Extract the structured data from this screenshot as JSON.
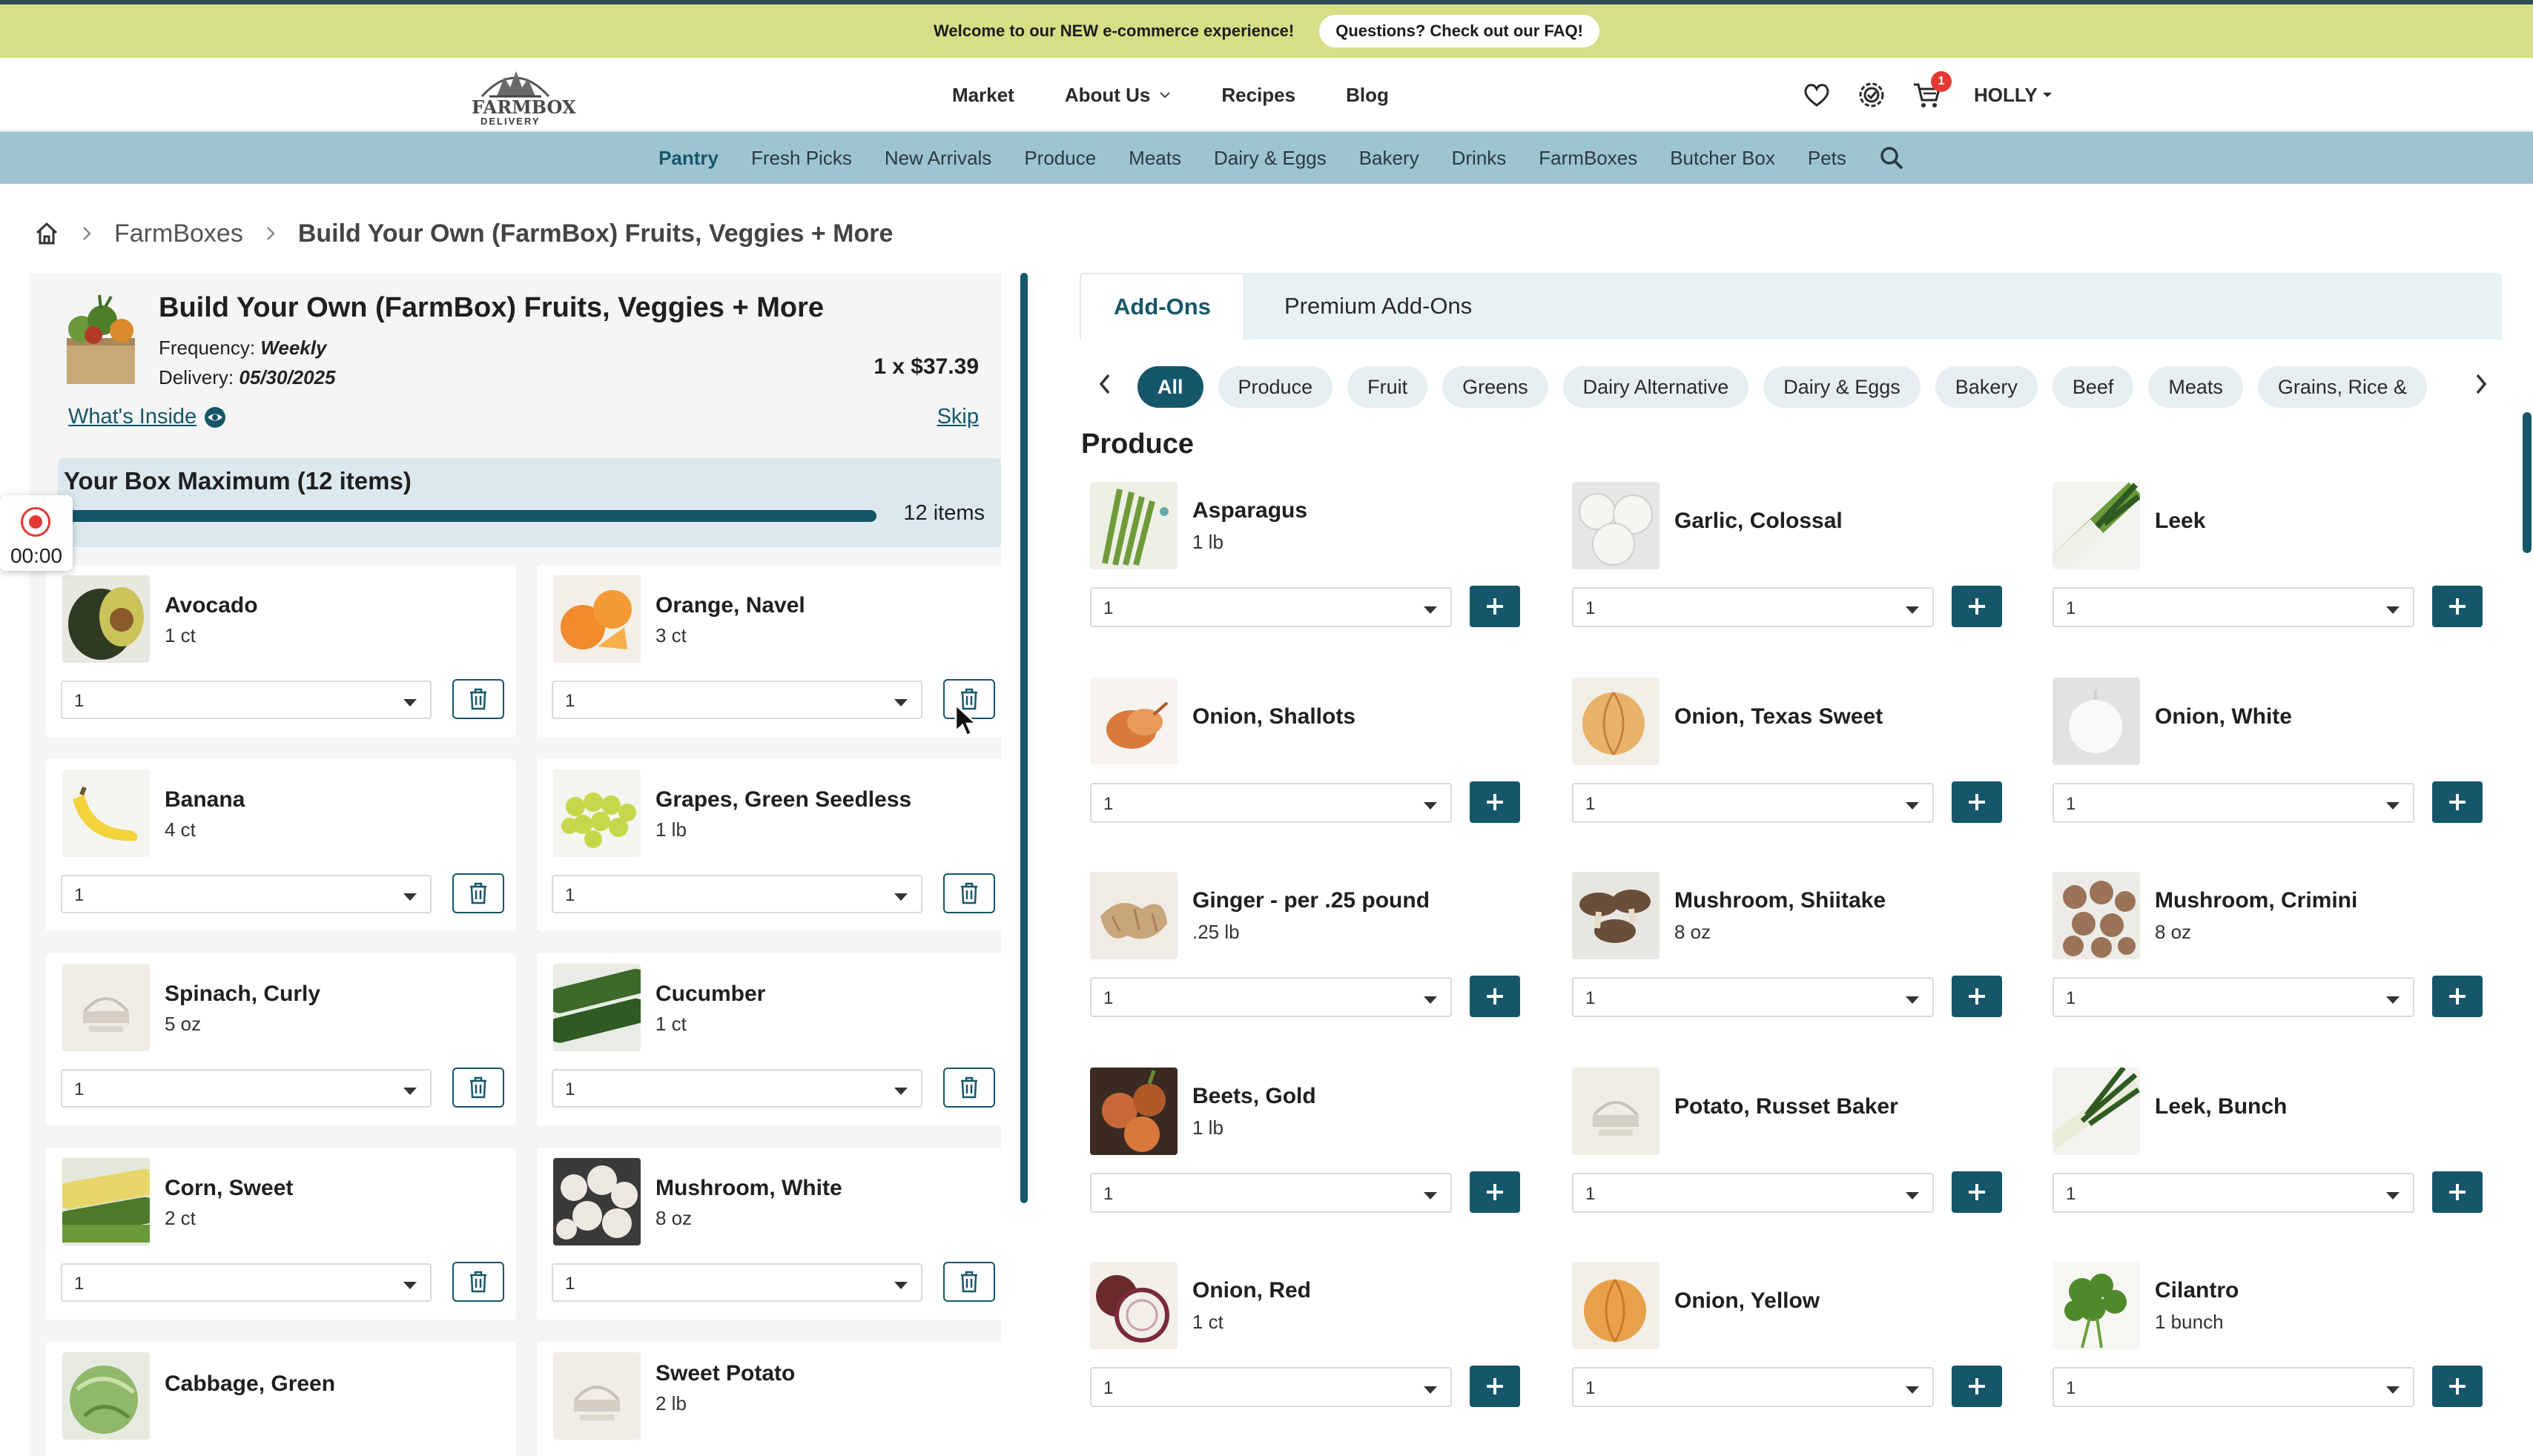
{
  "announcement": {
    "message": "Welcome to our NEW e-commerce experience!",
    "faq": "Questions? Check out our FAQ!"
  },
  "logo": {
    "line1": "FARMBOX",
    "line2": "DELIVERY"
  },
  "header": {
    "nav": [
      "Market",
      "About Us",
      "Recipes",
      "Blog"
    ],
    "cart_count": "1",
    "user": "HOLLY"
  },
  "categories": [
    "Pantry",
    "Fresh Picks",
    "New Arrivals",
    "Produce",
    "Meats",
    "Dairy & Eggs",
    "Bakery",
    "Drinks",
    "FarmBoxes",
    "Butcher Box",
    "Pets"
  ],
  "breadcrumb": {
    "level1": "FarmBoxes",
    "current": "Build Your Own (FarmBox) Fruits, Veggies + More"
  },
  "box": {
    "title": "Build Your Own (FarmBox) Fruits, Veggies + More",
    "frequency_label": "Frequency:",
    "frequency": "Weekly",
    "delivery_label": "Delivery:",
    "delivery": "05/30/2025",
    "price": "1 x $37.39",
    "whats_inside": "What's Inside",
    "skip": "Skip",
    "max_label": "Your Box Maximum (12 items)",
    "count": "12 items",
    "progress": 1.0
  },
  "recording": {
    "time": "00:00"
  },
  "box_items": [
    {
      "name": "Avocado",
      "qty": "1 ct",
      "value": "1"
    },
    {
      "name": "Orange, Navel",
      "qty": "3 ct",
      "value": "1"
    },
    {
      "name": "Banana",
      "qty": "4 ct",
      "value": "1"
    },
    {
      "name": "Grapes, Green Seedless",
      "qty": "1 lb",
      "value": "1"
    },
    {
      "name": "Spinach, Curly",
      "qty": "5 oz",
      "value": "1"
    },
    {
      "name": "Cucumber",
      "qty": "1 ct",
      "value": "1"
    },
    {
      "name": "Corn, Sweet",
      "qty": "2 ct",
      "value": "1"
    },
    {
      "name": "Mushroom, White",
      "qty": "8 oz",
      "value": "1"
    },
    {
      "name": "Cabbage, Green",
      "qty": "",
      "value": ""
    },
    {
      "name": "Sweet Potato",
      "qty": "2 lb",
      "value": ""
    }
  ],
  "addons": {
    "tabs": [
      "Add-Ons",
      "Premium Add-Ons"
    ],
    "chips": [
      "All",
      "Produce",
      "Fruit",
      "Greens",
      "Dairy Alternative",
      "Dairy & Eggs",
      "Bakery",
      "Beef",
      "Meats",
      "Grains, Rice &"
    ],
    "section": "Produce",
    "products": [
      {
        "name": "Asparagus",
        "qty": "1 lb",
        "value": "1"
      },
      {
        "name": "Garlic, Colossal",
        "qty": "",
        "value": "1"
      },
      {
        "name": "Leek",
        "qty": "",
        "value": "1"
      },
      {
        "name": "Onion, Shallots",
        "qty": "",
        "value": "1"
      },
      {
        "name": "Onion, Texas Sweet",
        "qty": "",
        "value": "1"
      },
      {
        "name": "Onion, White",
        "qty": "",
        "value": "1"
      },
      {
        "name": "Ginger - per .25 pound",
        "qty": ".25 lb",
        "value": "1"
      },
      {
        "name": "Mushroom, Shiitake",
        "qty": "8 oz",
        "value": "1"
      },
      {
        "name": "Mushroom, Crimini",
        "qty": "8 oz",
        "value": "1"
      },
      {
        "name": "Beets, Gold",
        "qty": "1 lb",
        "value": "1"
      },
      {
        "name": "Potato, Russet Baker",
        "qty": "",
        "value": "1"
      },
      {
        "name": "Leek, Bunch",
        "qty": "",
        "value": "1"
      },
      {
        "name": "Onion, Red",
        "qty": "1 ct",
        "value": "1"
      },
      {
        "name": "Onion, Yellow",
        "qty": "",
        "value": "1"
      },
      {
        "name": "Cilantro",
        "qty": "1 bunch",
        "value": "1"
      }
    ]
  }
}
